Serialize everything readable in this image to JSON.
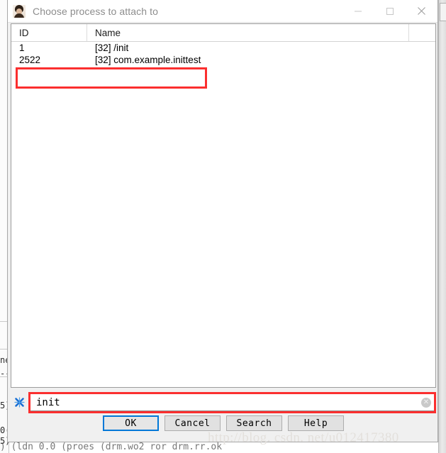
{
  "window": {
    "title": "Choose process to attach to",
    "icon": "person-photo-icon",
    "controls": {
      "minimize": "minimize-icon",
      "maximize": "maximize-icon",
      "close": "close-icon"
    }
  },
  "list": {
    "columns": [
      "ID",
      "Name"
    ],
    "rows": [
      {
        "id": "1",
        "name": "[32] /init"
      },
      {
        "id": "2522",
        "name": "[32] com.example.inittest"
      }
    ],
    "highlighted_row_index": 1
  },
  "filter": {
    "icon": "filter-clear-icon",
    "value": "init",
    "placeholder": "",
    "clear_icon": "clear-circle-icon"
  },
  "buttons": [
    {
      "label": "OK",
      "default": true
    },
    {
      "label": "Cancel",
      "default": false
    },
    {
      "label": "Search",
      "default": false
    },
    {
      "label": "Help",
      "default": false
    }
  ],
  "watermark": "http://blog. csdn. net/u012417380",
  "background": {
    "bottom_line": ") (ldn  0.0 (proes (drm.wo2  ror  drm.rr.ok",
    "fragment_a": "ne",
    "fragment_b": "--",
    "fragment_c": "5)",
    "fragment_d": "0(",
    "fragment_e": "5)"
  },
  "colors": {
    "annotation_red": "#fb2f2f",
    "focus_blue": "#0078d7",
    "title_text": "#8d8d8d",
    "watermark": "#e3e0dc"
  }
}
